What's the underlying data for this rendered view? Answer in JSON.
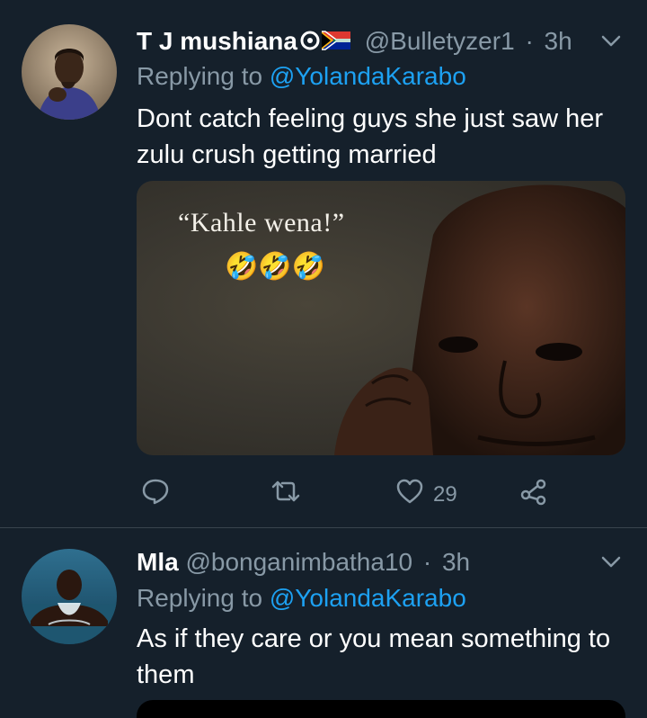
{
  "tweets": [
    {
      "display_name": "T J mushiana",
      "handle": "@Bulletyzer1",
      "separator": "·",
      "time": "3h",
      "replying_prefix": "Replying to",
      "replying_to": "@YolandaKarabo",
      "text_line1": "Dont catch feeling guys she just saw her",
      "text_line2": "zulu crush getting married",
      "media_caption": "“Kahle wena!”",
      "media_emojis": "🤣🤣🤣",
      "like_count": "29",
      "icons": [
        "reply-icon",
        "retweet-icon",
        "like-icon",
        "share-icon",
        "chevron-down-icon"
      ]
    },
    {
      "display_name": "Mla",
      "handle": "@bonganimbatha10",
      "separator": "·",
      "time": "3h",
      "replying_prefix": "Replying to",
      "replying_to": "@YolandaKarabo",
      "text_line1": "As if they care or you mean something to",
      "text_line2": "them"
    }
  ],
  "colors": {
    "background": "#15202b",
    "muted": "#8899a6",
    "accent": "#1da1f2",
    "divider": "#38444d"
  }
}
